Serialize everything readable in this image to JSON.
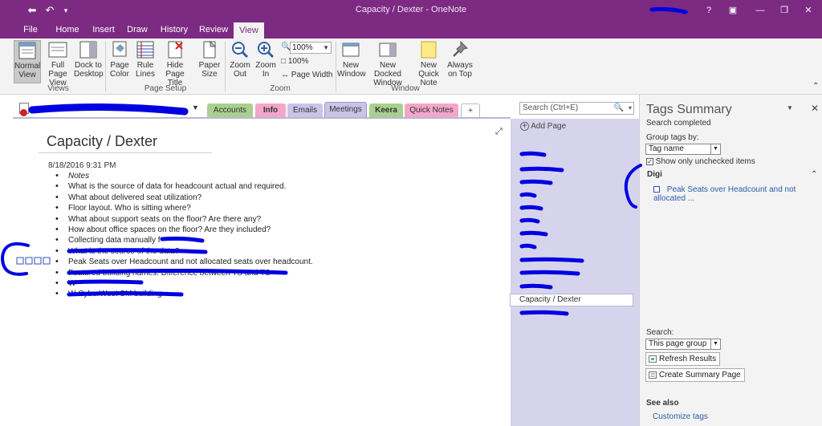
{
  "window": {
    "title": "Capacity / Dexter - OneNote"
  },
  "ribbon_tabs": [
    "File",
    "Home",
    "Insert",
    "Draw",
    "History",
    "Review",
    "View"
  ],
  "active_tab": "View",
  "ribbon": {
    "normal_view": "Normal View",
    "full_page_view": "Full Page View",
    "dock_to_desktop": "Dock to Desktop",
    "views_group": "Views",
    "page_color": "Page Color",
    "rule_lines": "Rule Lines",
    "hide_page_title": "Hide Page Title",
    "page_setup_group": "Page Setup",
    "paper_size": "Paper Size",
    "zoom_out": "Zoom Out",
    "zoom_in": "Zoom In",
    "zoom_value": "100%",
    "zoom_100": "100%",
    "page_width": "Page Width",
    "zoom_group": "Zoom",
    "new_window": "New Window",
    "new_docked_window": "New Docked Window",
    "new_quick_note": "New Quick Note",
    "always_on_top": "Always on Top",
    "window_group": "Window"
  },
  "section_tabs": [
    {
      "label": "Accounts",
      "color": "#a9d08e"
    },
    {
      "label": "Info",
      "color": "#f4a6c8"
    },
    {
      "label": "Emails",
      "color": "#c9c4e8"
    },
    {
      "label": "Meetings",
      "color": "#c9c4e8"
    },
    {
      "label": "Keera",
      "color": "#a9d08e"
    },
    {
      "label": "Quick Notes",
      "color": "#f4a6c8"
    },
    {
      "label": "+",
      "color": "#ffffff"
    }
  ],
  "search": {
    "placeholder": "Search (Ctrl+E)"
  },
  "page": {
    "title": "Capacity / Dexter",
    "date": "8/18/2016 9:31 PM",
    "notes": [
      "Notes",
      "What is the source of data for headcount actual and required.",
      "What about delivered seat utilization?",
      "Floor layout. Who is sitting where?",
      "What about support seats on the floor? Are there any?",
      "How about office spaces on the floor? Are they included?",
      "Collecting data manually f",
      "What is the source of the data?",
      "Peak Seats over Headcount and not allocated seats over headcount.",
      "Featured building names. Difference between TS and TS",
      "W",
      "W        CyberWest SM building"
    ]
  },
  "pages_pane": {
    "add_page": "Add Page",
    "selected_page": "Capacity / Dexter"
  },
  "tags_pane": {
    "title": "Tags Summary",
    "status": "Search completed",
    "group_by_label": "Group tags by:",
    "group_by_value": "Tag name",
    "show_unchecked": "Show only unchecked items",
    "group_name": "Digi",
    "tag_item": "Peak Seats over Headcount and not allocated ...",
    "search_label": "Search:",
    "search_scope": "This page group",
    "refresh": "Refresh Results",
    "create_summary": "Create Summary Page",
    "see_also": "See also",
    "customize_tags": "Customize tags"
  },
  "colors": {
    "brand": "#7c2a82",
    "pages_pane": "#d6d3ec",
    "redaction": "#0000e0"
  }
}
